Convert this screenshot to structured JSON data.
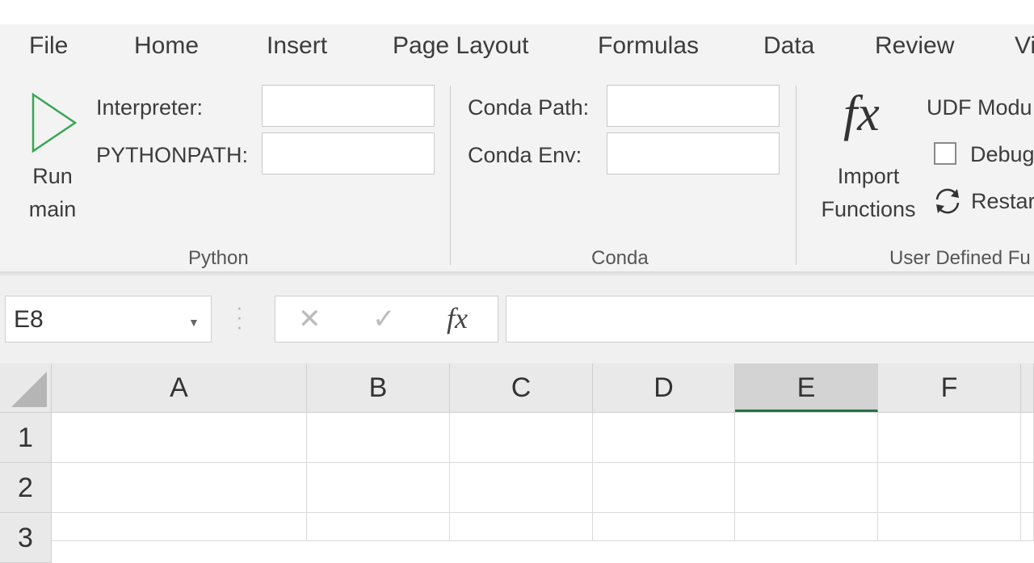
{
  "menu": {
    "tabs": [
      "File",
      "Home",
      "Insert",
      "Page Layout",
      "Formulas",
      "Data",
      "Review",
      "Vi"
    ]
  },
  "ribbon": {
    "python": {
      "run_label_line1": "Run",
      "run_label_line2": "main",
      "interpreter_label": "Interpreter:",
      "interpreter_value": "",
      "pythonpath_label": "PYTHONPATH:",
      "pythonpath_value": "",
      "group_label": "Python"
    },
    "conda": {
      "path_label": "Conda Path:",
      "path_value": "",
      "env_label": "Conda Env:",
      "env_value": "",
      "group_label": "Conda"
    },
    "udf": {
      "fx_glyph": "fx",
      "import_line1": "Import",
      "import_line2": "Functions",
      "modules_label": "UDF Modu",
      "debug_label": "Debug",
      "restart_label": "Restar",
      "group_label": "User Defined Fu"
    }
  },
  "formula_bar": {
    "name_box": "E8",
    "cancel_glyph": "✕",
    "enter_glyph": "✓",
    "fx_glyph": "fx",
    "formula_value": ""
  },
  "sheet": {
    "columns": [
      "A",
      "B",
      "C",
      "D",
      "E",
      "F"
    ],
    "selected_column": "E",
    "rows": [
      "1",
      "2",
      "3"
    ]
  },
  "colors": {
    "accent_green": "#217346",
    "run_icon": "#3aa655",
    "ribbon_bg": "#f3f3f3"
  },
  "icons": {
    "run": "play-triangle-icon",
    "restart": "refresh-icon",
    "namebox_dropdown": "caret-down-icon"
  }
}
